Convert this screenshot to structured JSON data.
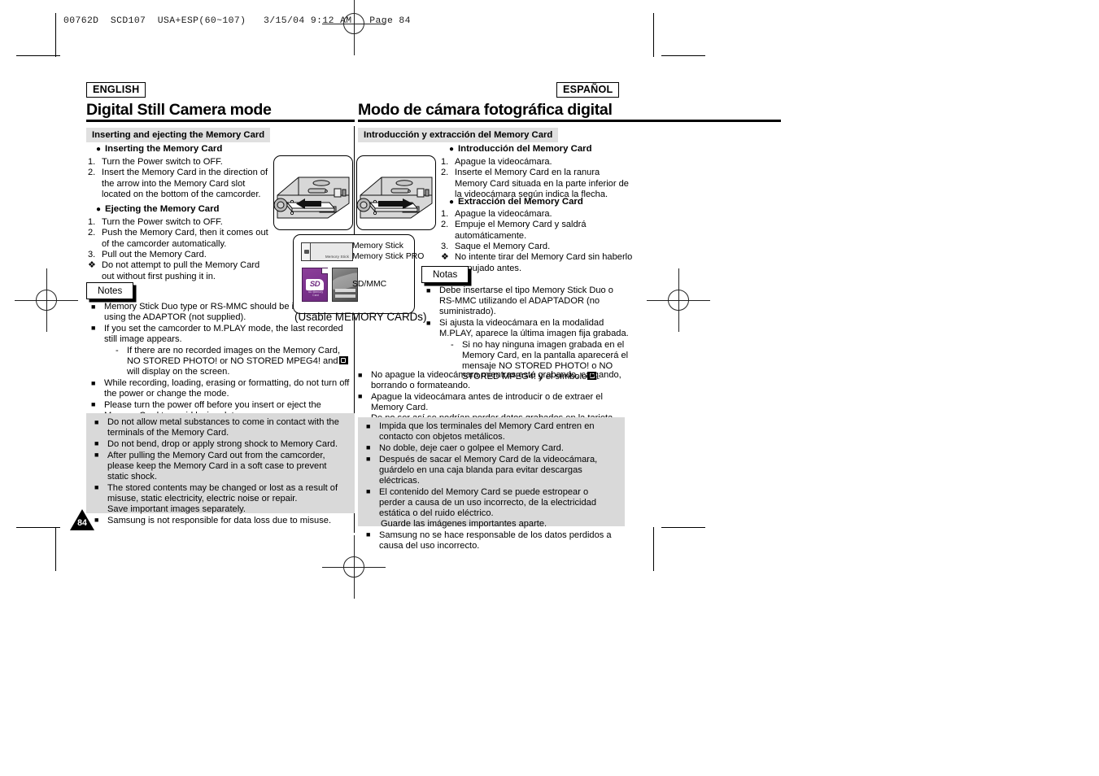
{
  "press": {
    "slug": "00762D  SCD107  USA+ESP(60~107)   3/15/04 9:12 AM   Page 84"
  },
  "english": {
    "badge": "ENGLISH",
    "title": "Digital Still Camera mode",
    "section_bar": "Inserting and ejecting the Memory Card",
    "insert_heading": "Inserting the Memory Card",
    "insert_steps": [
      "Turn the Power switch to OFF.",
      "Insert the Memory Card in the direction of the arrow into the Memory Card slot located on the bottom of the camcorder."
    ],
    "eject_heading": "Ejecting the Memory Card",
    "eject_steps": [
      "Turn the Power switch to OFF.",
      "Push the Memory Card, then it comes out of the camcorder automatically.",
      "Pull out the Memory Card."
    ],
    "eject_caution": "Do not attempt to pull the Memory Card out without first pushing it in.",
    "notes_label": "Notes",
    "notes": [
      "Memory Stick Duo type or RS-MMC should be inserted by using the ADAPTOR (not supplied).",
      "If you set the camcorder to M.PLAY mode, the last recorded still image appears.",
      "While recording, loading, erasing or formatting, do not turn off the power or change the mode.",
      "Please turn the power off before you insert or eject the Memory Card to avoid losing data."
    ],
    "note_sub_a": "If there are no recorded images on the Memory Card, NO STORED PHOTO! or NO STORED MPEG4! and",
    "note_sub_b": "will display on the screen.",
    "caution_block": [
      "Do not allow metal substances to come in contact with the terminals of the Memory Card.",
      "Do not bend, drop or apply strong shock to Memory Card.",
      "After pulling the Memory Card out from the camcorder, please keep the Memory Card in a soft case to prevent static shock.",
      "The stored contents may be changed or lost as a result of misuse, static electricity, electric noise or repair.",
      "Samsung is not responsible for data loss due to misuse."
    ],
    "caution_extra_line": "Save important images separately."
  },
  "spanish": {
    "badge": "ESPAÑOL",
    "title": "Modo de cámara fotográfica digital",
    "section_bar": "Introducción y extracción del Memory Card",
    "insert_heading": "Introducción del Memory Card",
    "insert_steps": [
      "Apague la videocámara.",
      "Inserte el Memory Card en la ranura Memory Card situada en la parte inferior de la videocámara según indica la flecha."
    ],
    "eject_heading": "Extracción del Memory Card",
    "eject_steps": [
      "Apague la videocámara.",
      "Empuje el Memory Card y saldrá automáticamente.",
      "Saque el Memory Card."
    ],
    "eject_caution": "No intente tirar del Memory Card sin haberlo empujado antes.",
    "notes_label": "Notas",
    "notes": [
      "Debe insertarse el tipo Memory Stick Duo o RS-MMC utilizando el  ADAPTADOR (no suministrado).",
      "Si ajusta la videocámara en la modalidad M.PLAY, aparece la última imagen fija grabada.",
      "No apague la videocámara mientras esté grabando, cargando, borrando o formateando.",
      "Apague la videocámara antes de introducir o de extraer el Memory Card."
    ],
    "note_sub_a": "Si no hay ninguna imagen grabada en el Memory Card, en la pantalla aparecerá el mensaje NO STORED PHOTO! o NO STORED MPEG4! y el símbolo",
    "note_sub_b": ".",
    "note_extra_line": "De no ser así se podrían perder datos grabados en la tarjeta.",
    "caution_block": [
      "Impida que los terminales del Memory Card entren en contacto con objetos metálicos.",
      "No doble, deje caer o golpee el Memory Card.",
      "Después de sacar el Memory Card de la videocámara, guárdelo en una caja blanda para evitar descargas eléctricas.",
      "El contenido del Memory Card se puede estropear o perder a causa de un uso incorrecto, de la electricidad estática o del ruido eléctrico.",
      "Samsung no se hace responsable de los datos perdidos a causa del uso incorrecto."
    ],
    "caution_extra_line": "Guarde las imágenes importantes aparte."
  },
  "figures": {
    "memory_stick_label_line1": "Memory Stick",
    "memory_stick_label_line2": "Memory Stick PRO",
    "sdmmc_label": "SD/MMC",
    "usable_caption": "(Usable MEMORY CARDs)",
    "ms_card_text": "Memory Stick",
    "sd_logo": "SD",
    "sd_sub": "SD Memory Card"
  },
  "page_number": "84",
  "colors": {
    "section_bar_bg": "#e0e0e0",
    "caution_bg": "#d9d9d9",
    "sd_purple": "#7e3490"
  }
}
